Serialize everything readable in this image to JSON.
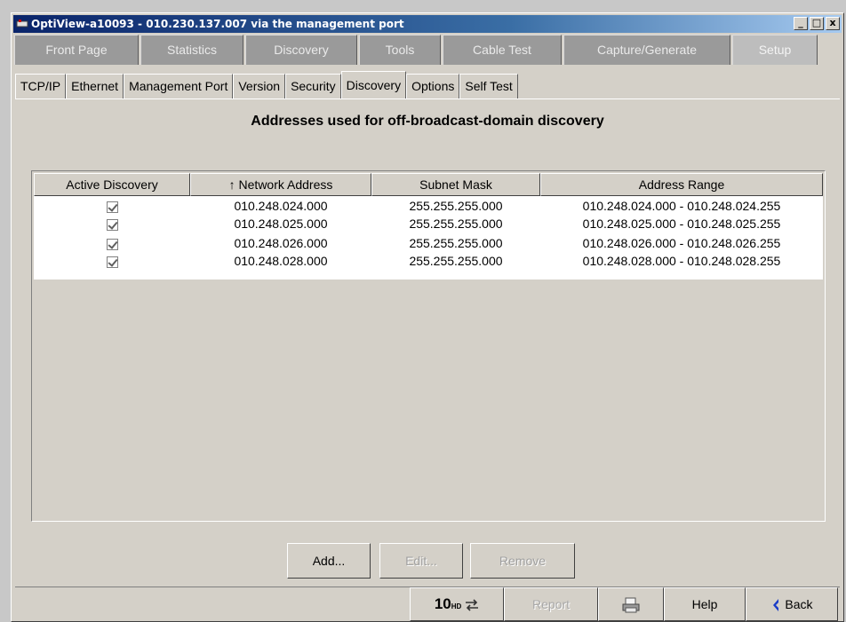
{
  "window": {
    "title": "OptiView-a10093 - 010.230.137.007 via the management port",
    "controls": [
      "_",
      "□",
      "x"
    ]
  },
  "main_tabs": [
    {
      "label": "Front Page"
    },
    {
      "label": "Statistics"
    },
    {
      "label": "Discovery"
    },
    {
      "label": "Tools"
    },
    {
      "label": "Cable Test"
    },
    {
      "label": "Capture/Generate"
    },
    {
      "label": "Setup"
    }
  ],
  "sub_tabs": [
    {
      "label": "TCP/IP"
    },
    {
      "label": "Ethernet"
    },
    {
      "label": "Management Port"
    },
    {
      "label": "Version"
    },
    {
      "label": "Security"
    },
    {
      "label": "Discovery"
    },
    {
      "label": "Options"
    },
    {
      "label": "Self Test"
    }
  ],
  "main": {
    "heading": "Addresses used for off-broadcast-domain discovery",
    "table": {
      "columns": [
        "Active Discovery",
        "↑ Network Address",
        "Subnet Mask",
        "Address Range"
      ],
      "rows": [
        {
          "active": true,
          "network": "010.248.024.000",
          "mask": "255.255.255.000",
          "range": "010.248.024.000 - 010.248.024.255"
        },
        {
          "active": true,
          "network": "010.248.025.000",
          "mask": "255.255.255.000",
          "range": "010.248.025.000 - 010.248.025.255"
        },
        {
          "active": true,
          "network": "010.248.026.000",
          "mask": "255.255.255.000",
          "range": "010.248.026.000 - 010.248.026.255"
        },
        {
          "active": true,
          "network": "010.248.028.000",
          "mask": "255.255.255.000",
          "range": "010.248.028.000 - 010.248.028.255"
        }
      ]
    },
    "buttons": {
      "add": "Add...",
      "edit": "Edit...",
      "remove": "Remove"
    }
  },
  "statusbar": {
    "link_speed": "10",
    "link_unit": "HD",
    "report": "Report",
    "help": "Help",
    "back": "Back"
  },
  "colors": {
    "title_start": "#0a246a",
    "title_end": "#a6caf0",
    "tab_bg": "#9a9a9a",
    "back_arrow": "#1a3cc8"
  }
}
